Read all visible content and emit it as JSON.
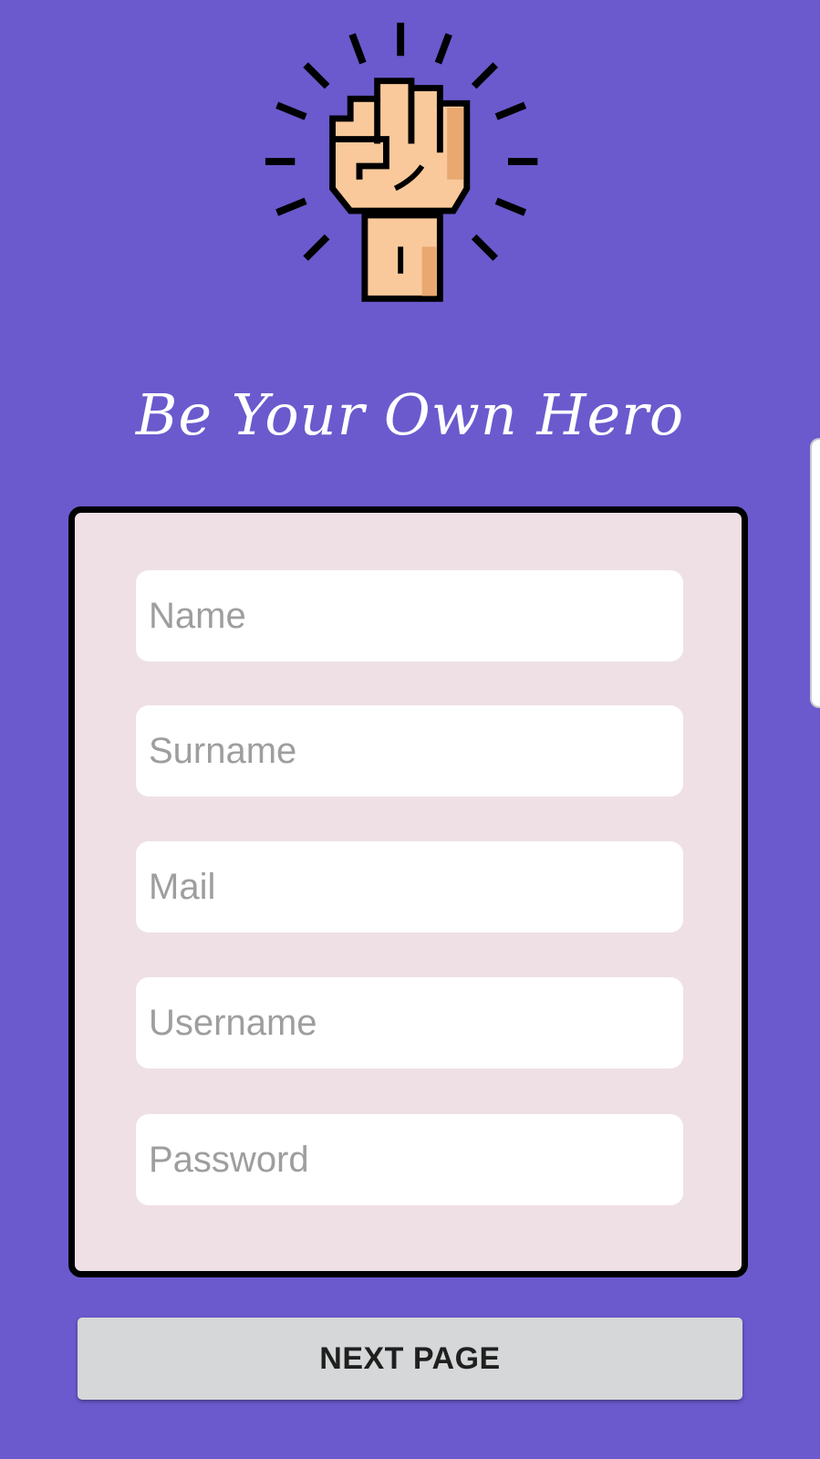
{
  "app": {
    "tagline": "Be Your Own Hero",
    "logo_icon": "raised-fist-icon"
  },
  "form": {
    "fields": [
      {
        "name": "name",
        "placeholder": "Name",
        "value": ""
      },
      {
        "name": "surname",
        "placeholder": "Surname",
        "value": ""
      },
      {
        "name": "mail",
        "placeholder": "Mail",
        "value": ""
      },
      {
        "name": "username",
        "placeholder": "Username",
        "value": ""
      },
      {
        "name": "password",
        "placeholder": "Password",
        "value": ""
      }
    ],
    "next_label": "NEXT PAGE"
  },
  "colors": {
    "background": "#6a5acd",
    "card": "#efe0e6",
    "card_border": "#000000",
    "button": "#d6d7d8",
    "skin": "#f9c99b",
    "skin_shadow": "#e8a870"
  }
}
